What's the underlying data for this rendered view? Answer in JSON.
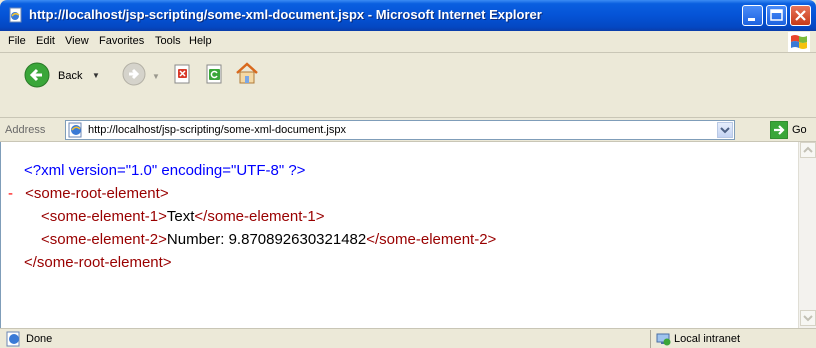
{
  "window": {
    "title": "http://localhost/jsp-scripting/some-xml-document.jspx - Microsoft Internet Explorer",
    "buttons": [
      "minimize-icon",
      "maximize-icon",
      "close-icon"
    ]
  },
  "menu": {
    "items": [
      "File",
      "Edit",
      "View",
      "Favorites",
      "Tools",
      "Help"
    ]
  },
  "toolbar": {
    "back_label": "Back",
    "icons": [
      "back-icon",
      "forward-icon",
      "stop-icon",
      "refresh-icon",
      "home-icon"
    ]
  },
  "address": {
    "label": "Address",
    "url": "http://localhost/jsp-scripting/some-xml-document.jspx",
    "go_label": "Go"
  },
  "document": {
    "declaration": "<?xml version=\"1.0\" encoding=\"UTF-8\" ?>",
    "collapse_marker": "-",
    "root_open": "<some-root-element>",
    "elements": [
      {
        "open": "<some-element-1>",
        "text": "Text",
        "close": "</some-element-1>"
      },
      {
        "open": "<some-element-2>",
        "text": "Number: 9.870892630321482",
        "close": "</some-element-2>"
      }
    ],
    "root_close": "</some-root-element>"
  },
  "status": {
    "text": "Done",
    "zone": "Local intranet"
  },
  "colors": {
    "tag": "#0000ff",
    "element_name": "#990000",
    "collapse": "#ff0000",
    "title_bar": "#0553d6"
  }
}
